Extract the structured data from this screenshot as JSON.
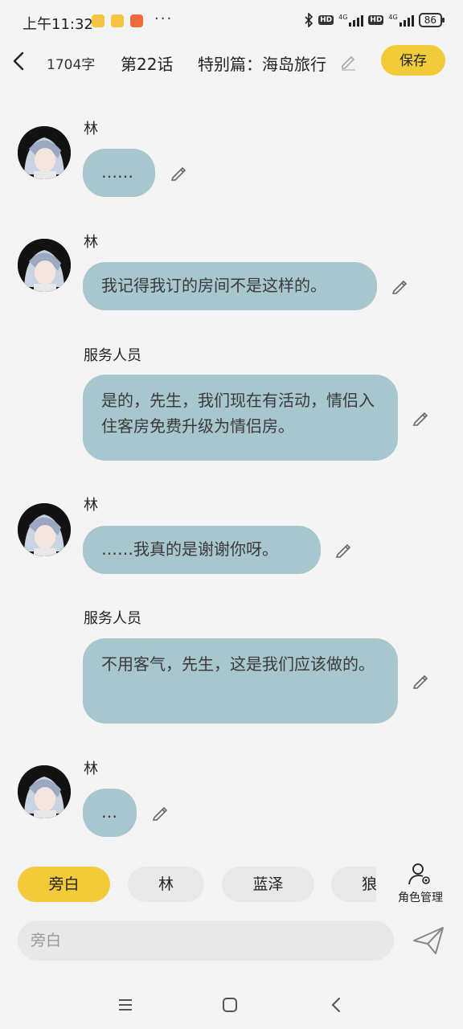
{
  "status_bar": {
    "time": "上午11:32",
    "battery": "86",
    "network": "4G",
    "hd": "HD"
  },
  "header": {
    "word_count": "1704字",
    "chapter": "第22话",
    "title": "特别篇：海岛旅行",
    "save_label": "保存"
  },
  "messages": [
    {
      "speaker": "林",
      "text": "……",
      "has_avatar": true
    },
    {
      "speaker": "林",
      "text": "我记得我订的房间不是这样的。",
      "has_avatar": true
    },
    {
      "speaker": "服务人员",
      "text": "是的，先生，我们现在有活动，情侣入住客房免费升级为情侣房。",
      "has_avatar": false
    },
    {
      "speaker": "林",
      "text": "……我真的是谢谢你呀。",
      "has_avatar": true
    },
    {
      "speaker": "服务人员",
      "text": "不用客气，先生，这是我们应该做的。",
      "has_avatar": false
    },
    {
      "speaker": "林",
      "text": "…",
      "has_avatar": true
    }
  ],
  "role_chips": [
    {
      "label": "旁白",
      "active": true
    },
    {
      "label": "林",
      "active": false
    },
    {
      "label": "蓝泽",
      "active": false
    },
    {
      "label": "狼",
      "active": false
    }
  ],
  "role_manage_label": "角色管理",
  "input": {
    "placeholder": "旁白"
  },
  "colors": {
    "accent": "#f2cb3a",
    "bubble": "#a7c6cd",
    "background": "#f4f4f4"
  },
  "icons": [
    "back-arrow-icon",
    "pencil-icon",
    "role-manage-icon",
    "send-icon",
    "menu-icon",
    "home-icon",
    "nav-back-icon"
  ]
}
